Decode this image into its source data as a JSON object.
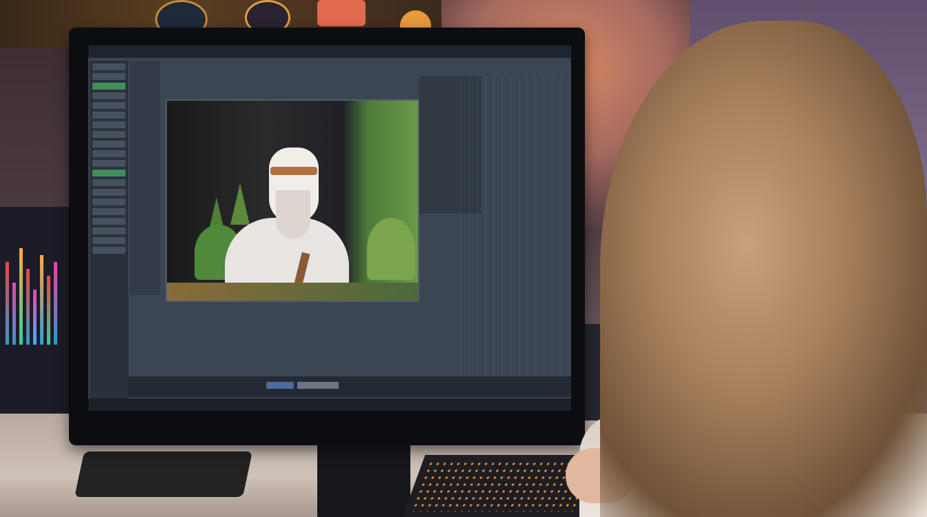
{
  "scene": {
    "subject": "",
    "screen_menu": [
      "",
      "",
      "",
      "",
      "",
      "",
      ""
    ]
  },
  "colors": {
    "screen_bg": "#3c4554",
    "timeline_accent": "#4c6aa0",
    "panel_green": "#3e8f5a"
  }
}
